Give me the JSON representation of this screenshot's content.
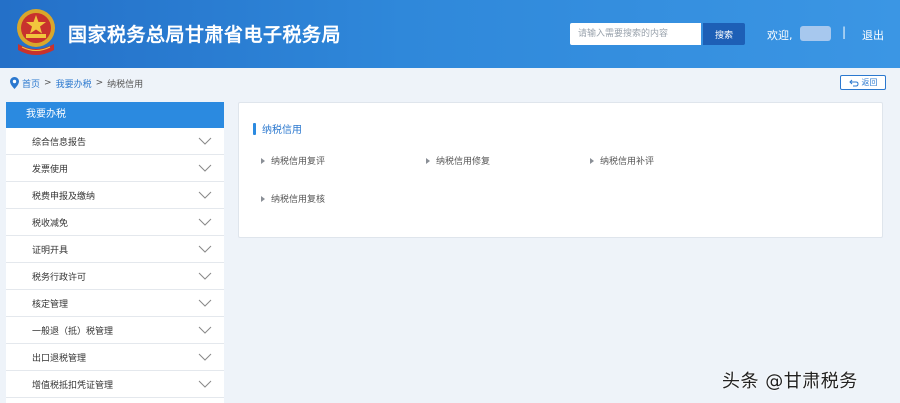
{
  "header": {
    "site_title": "国家税务总局甘肃省电子税务局",
    "search_placeholder": "请输入需要搜索的内容",
    "search_button": "搜索",
    "welcome": "欢迎,",
    "separator": "|",
    "logout": "退出"
  },
  "breadcrumb": {
    "items": [
      "首页",
      "我要办税",
      "纳税信用"
    ],
    "separator": ">"
  },
  "back_button": "返回",
  "sidebar": {
    "title": "我要办税",
    "items": [
      "综合信息报告",
      "发票使用",
      "税费申报及缴纳",
      "税收减免",
      "证明开具",
      "税务行政许可",
      "核定管理",
      "一般退（抵）税管理",
      "出口退税管理",
      "增值税抵扣凭证管理"
    ]
  },
  "panel": {
    "title": "纳税信用",
    "services": [
      "纳税信用复评",
      "纳税信用修复",
      "纳税信用补评",
      "纳税信用复核"
    ]
  },
  "watermark": "头条 @甘肃税务",
  "colors": {
    "header_blue": "#2f88da",
    "sidebar_active": "#2b8ae0",
    "link_blue": "#2b78cf"
  }
}
